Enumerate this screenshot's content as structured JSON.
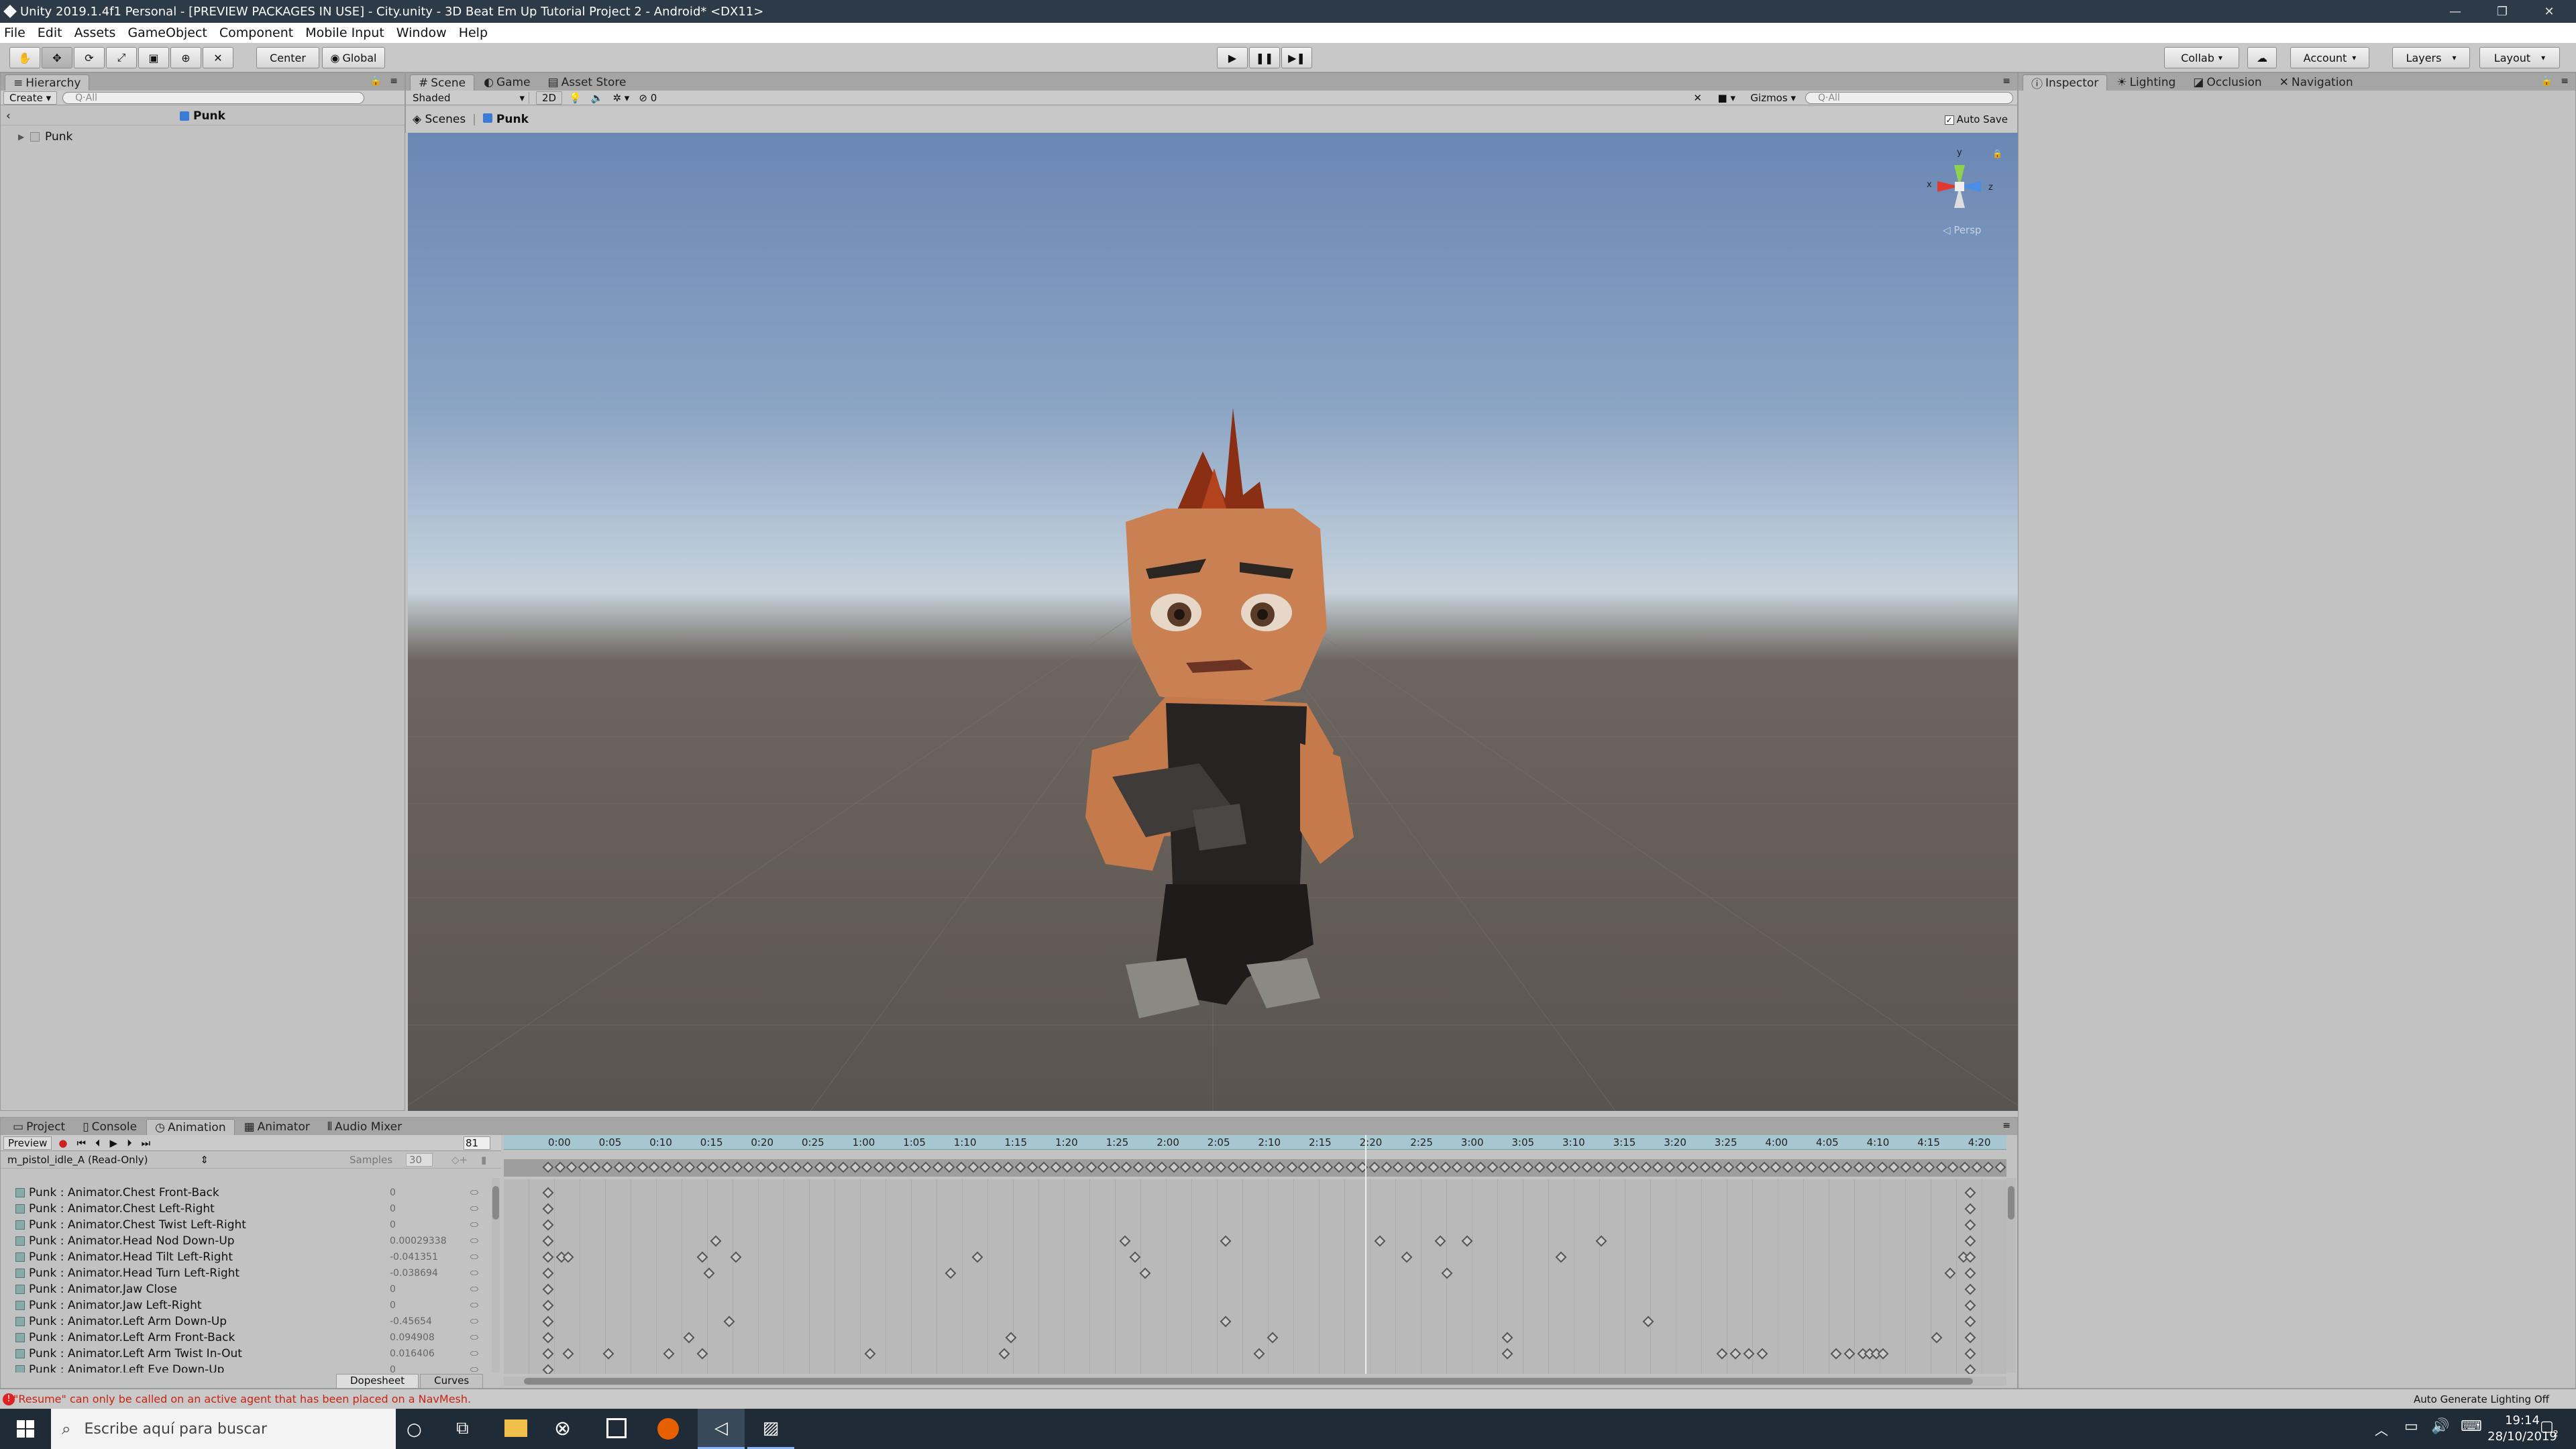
{
  "window": {
    "title": "Unity 2019.1.4f1 Personal - [PREVIEW PACKAGES IN USE] - City.unity - 3D Beat Em Up Tutorial Project 2 - Android* <DX11>"
  },
  "menu": [
    "File",
    "Edit",
    "Assets",
    "GameObject",
    "Component",
    "Mobile Input",
    "Window",
    "Help"
  ],
  "toolbar": {
    "pivot": "Center",
    "space": "Global",
    "collab": "Collab",
    "account": "Account",
    "layers": "Layers",
    "layout": "Layout"
  },
  "hierarchy": {
    "tab": "Hierarchy",
    "create": "Create",
    "search_placeholder": "Q·All",
    "scene_header": "Punk",
    "items": [
      "Punk"
    ]
  },
  "scene": {
    "tabs": [
      "Scene",
      "Game",
      "Asset Store"
    ],
    "shading": "Shaded",
    "mode_2d": "2D",
    "fx_count": "0",
    "gizmos": "Gizmos",
    "search_placeholder": "Q·All",
    "breadcrumb_root": "Scenes",
    "breadcrumb_item": "Punk",
    "auto_save": "Auto Save",
    "persp": "Persp",
    "gizmo_axes": {
      "y": "y",
      "x": "x",
      "z": "z"
    }
  },
  "inspector": {
    "tabs": [
      "Inspector",
      "Lighting",
      "Occlusion",
      "Navigation"
    ]
  },
  "bottom": {
    "tabs": [
      "Project",
      "Console",
      "Animation",
      "Animator",
      "Audio Mixer"
    ],
    "preview": "Preview",
    "frame": "81",
    "clip": "m_pistol_idle_A (Read-Only)",
    "samples_label": "Samples",
    "samples_value": "30",
    "timeline_ticks": [
      "0:00",
      "0:05",
      "0:10",
      "0:15",
      "0:20",
      "0:25",
      "1:00",
      "1:05",
      "1:10",
      "1:15",
      "1:20",
      "1:25",
      "2:00",
      "2:05",
      "2:10",
      "2:15",
      "2:20",
      "2:25",
      "3:00",
      "3:05",
      "3:10",
      "3:15",
      "3:20",
      "3:25",
      "4:00",
      "4:05",
      "4:10",
      "4:15",
      "4:20"
    ],
    "properties": [
      {
        "name": "Punk : Animator.Chest Front-Back",
        "value": "0"
      },
      {
        "name": "Punk : Animator.Chest Left-Right",
        "value": "0"
      },
      {
        "name": "Punk : Animator.Chest Twist Left-Right",
        "value": "0"
      },
      {
        "name": "Punk : Animator.Head Nod Down-Up",
        "value": "0.00029338"
      },
      {
        "name": "Punk : Animator.Head Tilt Left-Right",
        "value": "-0.041351"
      },
      {
        "name": "Punk : Animator.Head Turn Left-Right",
        "value": "-0.038694"
      },
      {
        "name": "Punk : Animator.Jaw Close",
        "value": "0"
      },
      {
        "name": "Punk : Animator.Jaw Left-Right",
        "value": "0"
      },
      {
        "name": "Punk : Animator.Left Arm Down-Up",
        "value": "-0.45654"
      },
      {
        "name": "Punk : Animator.Left Arm Front-Back",
        "value": "0.094908"
      },
      {
        "name": "Punk : Animator.Left Arm Twist In-Out",
        "value": "0.016406"
      },
      {
        "name": "Punk : Animator.Left Eye Down-Up",
        "value": "0"
      }
    ],
    "view_tabs": [
      "Dopesheet",
      "Curves"
    ]
  },
  "status": {
    "message": "\"Resume\" can only be called on an active agent that has been placed on a NavMesh.",
    "lighting": "Auto Generate Lighting Off"
  },
  "taskbar": {
    "search_placeholder": "Escribe aquí para buscar",
    "time": "19:14",
    "date": "28/10/2019",
    "notifications": "2"
  }
}
